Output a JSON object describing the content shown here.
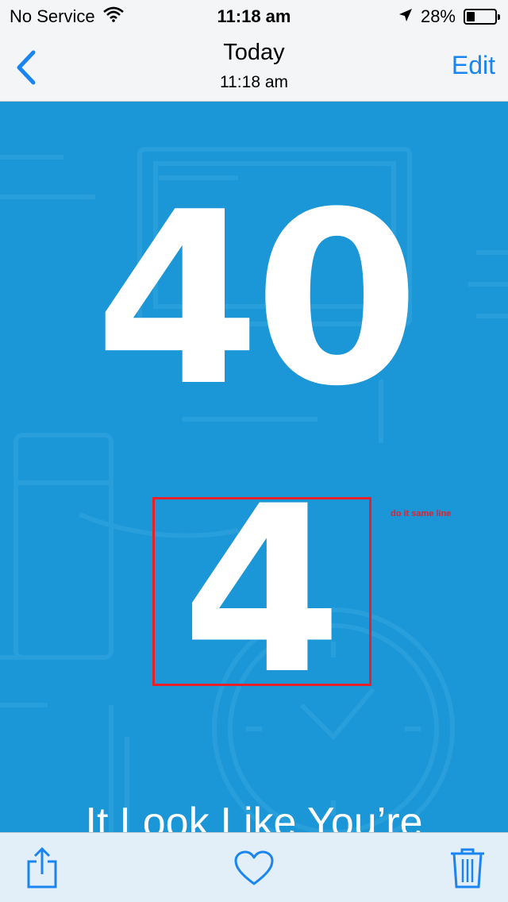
{
  "status_bar": {
    "carrier": "No Service",
    "time": "11:18 am",
    "battery_percent": "28%",
    "battery_level": 0.28,
    "icons": [
      "wifi-icon",
      "location-arrow-icon",
      "battery-icon"
    ]
  },
  "nav_bar": {
    "back_icon": "chevron-left-icon",
    "title": "Today",
    "subtitle": "11:18 am",
    "edit_label": "Edit",
    "accent_color": "#1a84f0"
  },
  "content": {
    "background_color": "#1b96d7",
    "big_digits": "40",
    "single_digit": "4",
    "annotation": "do it same line",
    "annotation_color": "#e8202a",
    "headline": "It Look Like You’re"
  },
  "toolbar": {
    "icons": [
      "share-icon",
      "heart-icon",
      "trash-icon"
    ],
    "icon_color": "#1a84f0"
  }
}
